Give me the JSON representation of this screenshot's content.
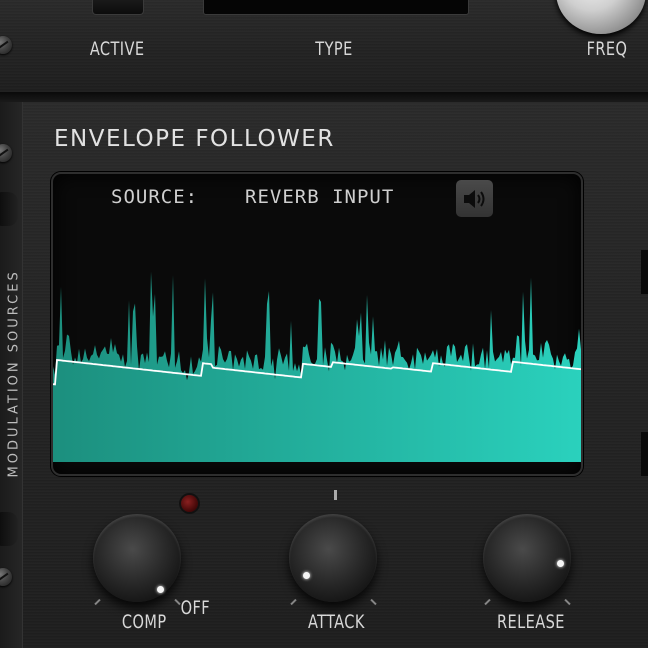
{
  "top_panel": {
    "active_label": "ACTIVE",
    "type_label": "TYPE",
    "freq_label": "FREQ"
  },
  "envelope_follower": {
    "title": "ENVELOPE FOLLOWER",
    "source_label": "SOURCE:",
    "source_value": "REVERB INPUT",
    "speaker_icon": "speaker-icon"
  },
  "knobs": {
    "comp_label": "COMP",
    "comp_off_label": "OFF",
    "attack_label": "ATTACK",
    "release_label": "RELEASE"
  },
  "side": {
    "modulation_sources_label": "MODULATION SOURCES"
  },
  "colors": {
    "waveform_fill_start": "#1c8f7e",
    "waveform_fill_end": "#2ad1bd",
    "envelope_line": "#ffffff",
    "lcd_text": "#cfcfcf",
    "led_off": "#6a1818"
  }
}
